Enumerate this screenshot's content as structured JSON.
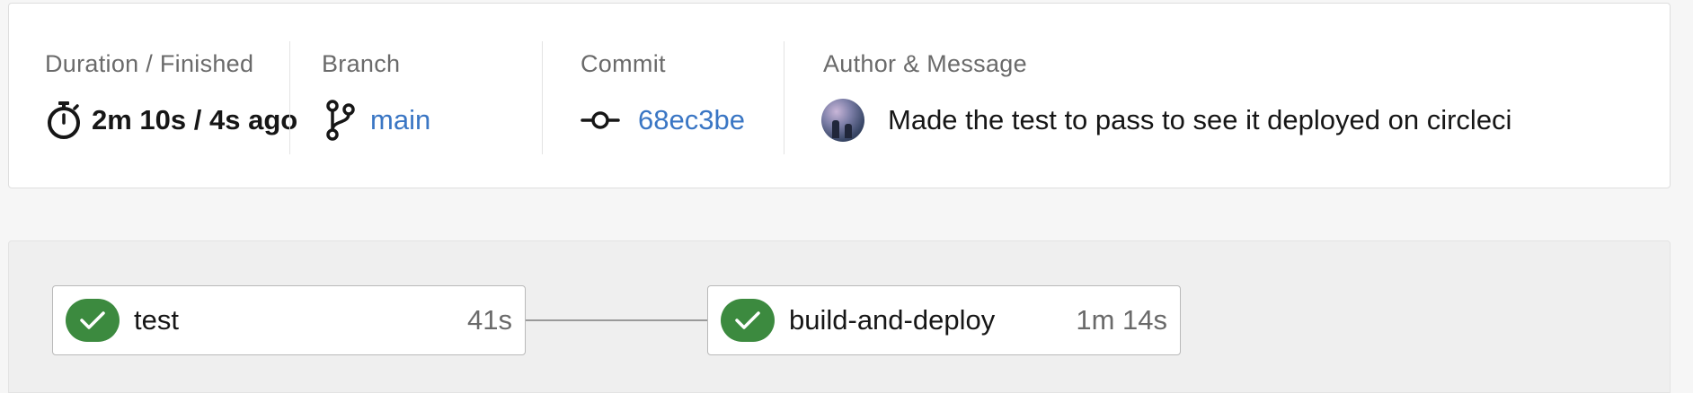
{
  "summary": {
    "duration": {
      "label": "Duration / Finished",
      "value": "2m 10s / 4s ago",
      "icon": "stopwatch-icon"
    },
    "branch": {
      "label": "Branch",
      "value": "main",
      "icon": "git-branch-icon"
    },
    "commit": {
      "label": "Commit",
      "value": "68ec3be",
      "icon": "git-commit-icon"
    },
    "author": {
      "label": "Author & Message",
      "message": "Made the test to pass to see it deployed on circleci",
      "icon": "avatar"
    }
  },
  "workflow": {
    "jobs": [
      {
        "name": "test",
        "duration": "41s",
        "status": "success"
      },
      {
        "name": "build-and-deploy",
        "duration": "1m 14s",
        "status": "success"
      }
    ]
  },
  "colors": {
    "link": "#3a76c4",
    "success": "#3c8a3f",
    "label": "#6a6a6a"
  }
}
